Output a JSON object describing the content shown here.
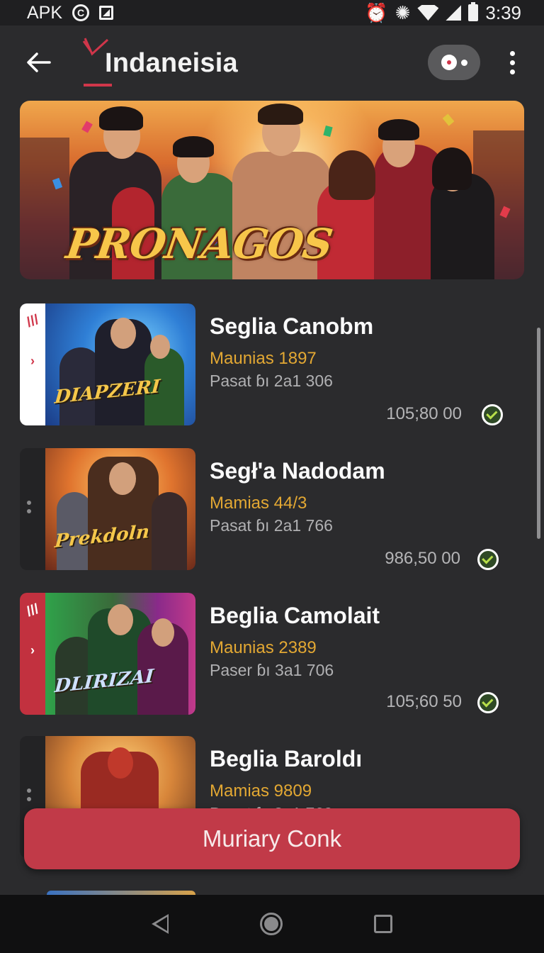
{
  "status_bar": {
    "left_text": "APK",
    "time": "3:39"
  },
  "app_bar": {
    "title": "Indaneisia"
  },
  "banner": {
    "title": "PRONAGOS"
  },
  "items": [
    {
      "title": "Seglia Canobm",
      "subtitle": "Maunias 1897",
      "meta": "Pasat ɓı 2a1 306",
      "price": "105;80 00",
      "thumb_logo": "DIAPZERI",
      "tab": "white"
    },
    {
      "title": "Segł'a Nadodam",
      "subtitle": "Mamias 44/3",
      "meta": "Pasat ɓı 2a1 766",
      "price": "986,50 00",
      "thumb_logo": "Prekdoln",
      "tab": "none"
    },
    {
      "title": "Beglia Camolait",
      "subtitle": "Maunias 2389",
      "meta": "Paser ɓı 3a1 706",
      "price": "105;60 50",
      "thumb_logo": "DLIRIZAI",
      "tab": "red"
    },
    {
      "title": "Beglia Baroldı",
      "subtitle": "Mamias 9809",
      "meta": "Pasat ɓı 8a1 769",
      "price": "",
      "thumb_logo": "",
      "tab": "none"
    }
  ],
  "cta": {
    "label": "Muriary Conk"
  },
  "colors": {
    "accent": "#c13a48",
    "subtitle": "#e3a833",
    "background": "#2b2b2d"
  }
}
